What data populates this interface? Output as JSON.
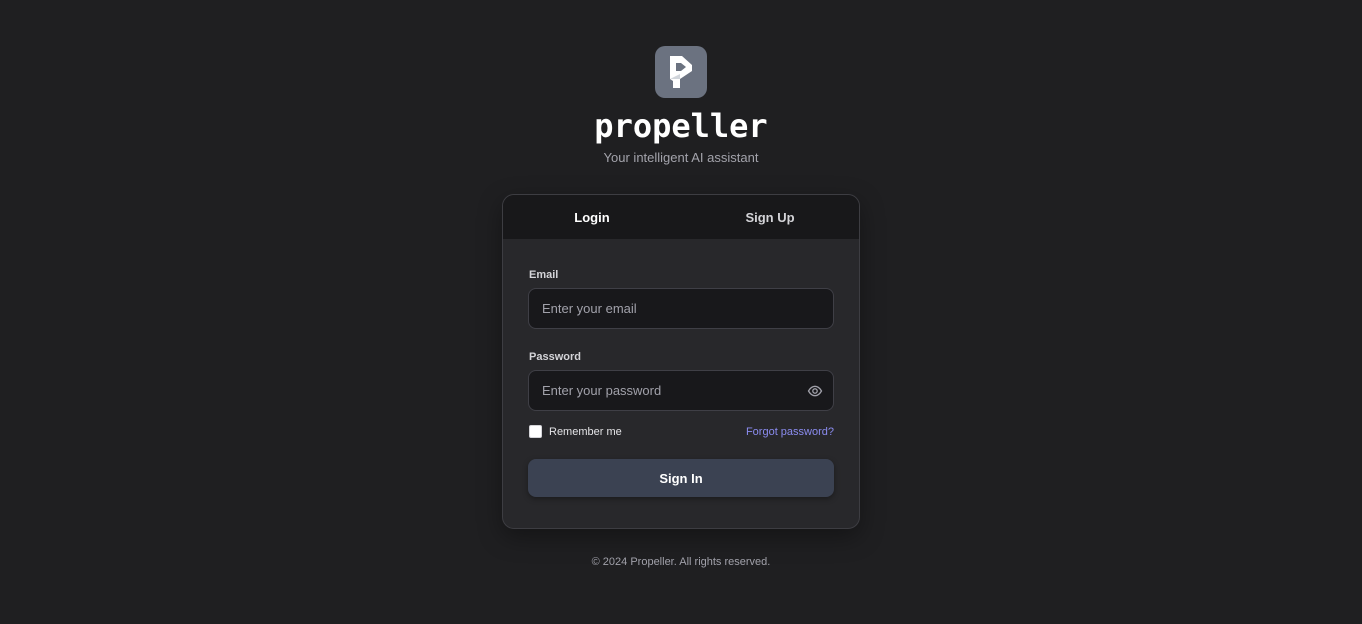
{
  "brand": {
    "name": "propeller",
    "tagline": "Your intelligent AI assistant",
    "logo_icon": "propeller-logo-icon",
    "logo_bg": "#6b7280"
  },
  "tabs": [
    {
      "label": "Login",
      "active": true
    },
    {
      "label": "Sign Up",
      "active": false
    }
  ],
  "form": {
    "email_label": "Email",
    "email_placeholder": "Enter your email",
    "email_value": "",
    "password_label": "Password",
    "password_placeholder": "Enter your password",
    "password_value": "",
    "password_toggle_icon": "eye-icon",
    "remember_label": "Remember me",
    "remember_checked": false,
    "forgot_label": "Forgot password?",
    "submit_label": "Sign In"
  },
  "footer": {
    "copyright": "© 2024 Propeller. All rights reserved."
  },
  "colors": {
    "background": "#1f1f21",
    "card": "#28282b",
    "link": "#8b8cf0",
    "button": "#3b4252"
  }
}
